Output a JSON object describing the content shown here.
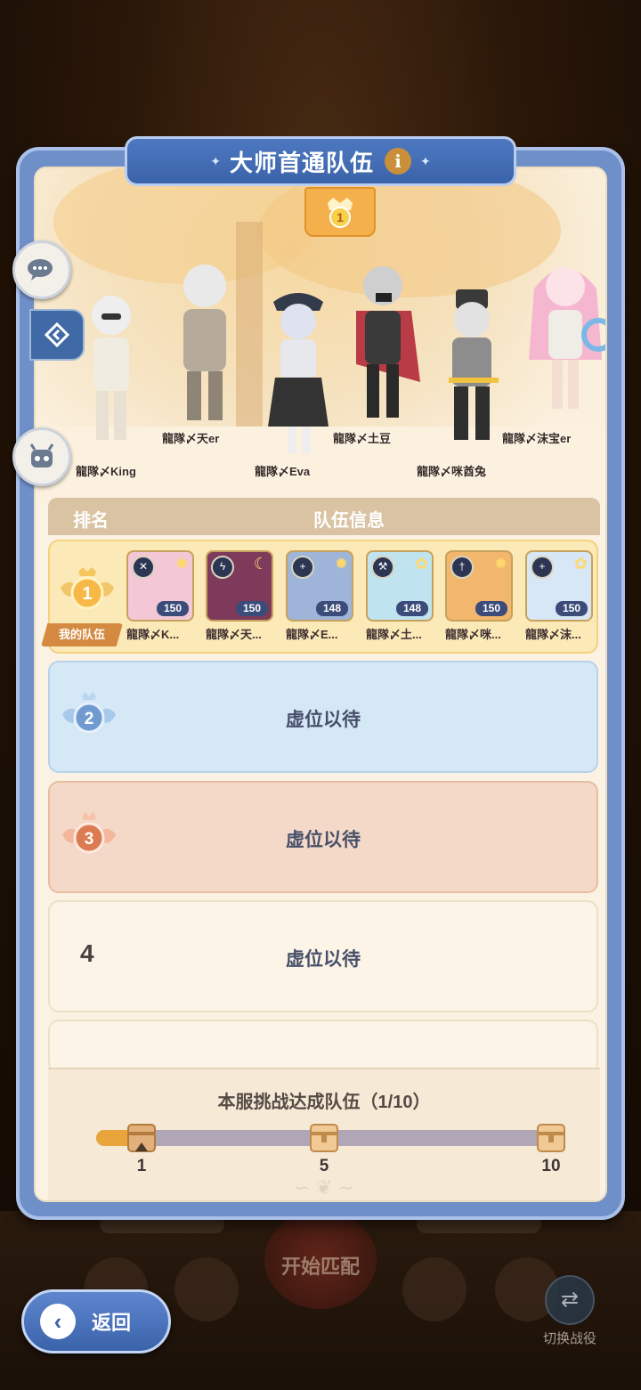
{
  "panel": {
    "title": "大师首通队伍",
    "info_icon": "info-icon",
    "showcase_rank": "1"
  },
  "showcase": {
    "characters": [
      {
        "name": "龍隊〆King"
      },
      {
        "name": "龍隊〆天er"
      },
      {
        "name": "龍隊〆Eva"
      },
      {
        "name": "龍隊〆土豆"
      },
      {
        "name": "龍隊〆咪酋兔"
      },
      {
        "name": "龍隊〆沫宝er"
      }
    ]
  },
  "table": {
    "header_rank": "排名",
    "header_info": "队伍信息",
    "rows": [
      {
        "rank": "1",
        "my_team_label": "我的队伍",
        "heroes": [
          {
            "name": "龍隊〆K...",
            "level": "150",
            "class_icon": "dual-blade-icon",
            "color": "#f3c7d6"
          },
          {
            "name": "龍隊〆天...",
            "level": "150",
            "class_icon": "lightning-icon",
            "color": "#7d3a5a"
          },
          {
            "name": "龍隊〆E...",
            "level": "148",
            "class_icon": "cross-icon",
            "color": "#9eb5d9"
          },
          {
            "name": "龍隊〆土...",
            "level": "148",
            "class_icon": "hammer-icon",
            "color": "#bfe3ef"
          },
          {
            "name": "龍隊〆咪...",
            "level": "150",
            "class_icon": "sword-icon",
            "color": "#f2b66c"
          },
          {
            "name": "龍隊〆沫...",
            "level": "150",
            "class_icon": "cross-icon",
            "color": "#d8e7f6"
          }
        ]
      },
      {
        "rank": "2",
        "text": "虚位以待"
      },
      {
        "rank": "3",
        "text": "虚位以待"
      },
      {
        "rank": "4",
        "text": "虚位以待"
      }
    ]
  },
  "progress": {
    "title": "本服挑战达成队伍（1/10）",
    "current": 1,
    "max": 10,
    "milestones": [
      "1",
      "5",
      "10"
    ]
  },
  "background": {
    "start_match": "开始匹配",
    "switch_label": "切换战役"
  },
  "back_button": {
    "label": "返回"
  },
  "colors": {
    "panel_blue": "#6f8fc9",
    "gold": "#f4b14b",
    "progress_fill": "#eaa43c"
  }
}
